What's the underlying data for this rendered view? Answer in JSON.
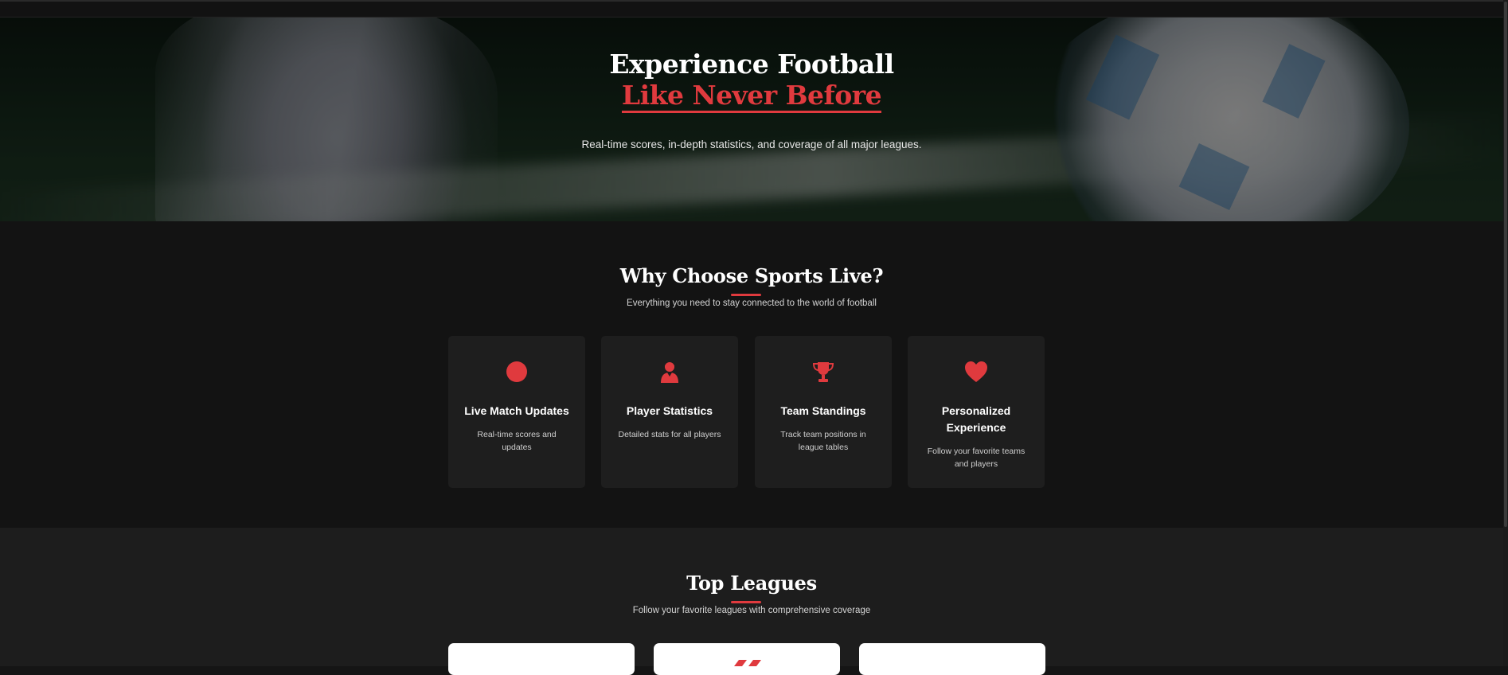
{
  "hero": {
    "title_line1": "Experience Football",
    "title_line2": "Like Never Before",
    "subtitle": "Real-time scores, in-depth statistics, and coverage of all major leagues."
  },
  "why": {
    "title": "Why Choose Sports Live?",
    "subtitle": "Everything you need to stay connected to the world of football",
    "features": [
      {
        "icon": "circle-icon",
        "title": "Live Match Updates",
        "desc": "Real-time scores and updates"
      },
      {
        "icon": "user-icon",
        "title": "Player Statistics",
        "desc": "Detailed stats for all players"
      },
      {
        "icon": "trophy-icon",
        "title": "Team Standings",
        "desc": "Track team positions in league tables"
      },
      {
        "icon": "heart-icon",
        "title": "Personalized Experience",
        "desc": "Follow your favorite teams and players"
      }
    ]
  },
  "leagues": {
    "title": "Top Leagues",
    "subtitle": "Follow your favorite leagues with comprehensive coverage"
  },
  "colors": {
    "accent": "#e03a3e",
    "background": "#131313",
    "card": "#1e1e1e"
  }
}
